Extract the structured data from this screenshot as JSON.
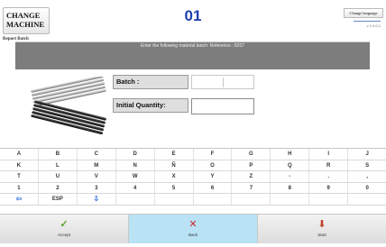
{
  "header": {
    "change_machine": "CHANGE\nMACHINE",
    "screen_title": "Report Batch",
    "screen_number": "01",
    "change_language": "Change language",
    "version": "v 1.0.0.1"
  },
  "message": {
    "text": "Enter the following material batch: Reference : 8207"
  },
  "form": {
    "batch_label": "Batch :",
    "batch_value": "",
    "initial_quantity_label": "Initial Quantity:",
    "initial_quantity_value": ""
  },
  "keyboard": {
    "rows": [
      [
        "A",
        "B",
        "C",
        "D",
        "E",
        "F",
        "G",
        "H",
        "I",
        "J"
      ],
      [
        "K",
        "L",
        "M",
        "N",
        "Ñ",
        "O",
        "P",
        "Q",
        "R",
        "S"
      ],
      [
        "T",
        "U",
        "V",
        "W",
        "X",
        "Y",
        "Z",
        "-",
        ".",
        ","
      ],
      [
        "1",
        "2",
        "3",
        "4",
        "5",
        "6",
        "7",
        "8",
        "9",
        "0"
      ],
      [
        "⇦",
        "ESP",
        "⇩",
        "",
        "",
        "",
        "",
        "",
        "",
        ""
      ]
    ]
  },
  "actions": {
    "accept": "Accept",
    "back": "Back",
    "start": "Start"
  },
  "icons": {
    "accept": "check-icon",
    "back": "x-icon",
    "start": "start-icon"
  },
  "colors": {
    "title_blue": "#1f3fb0",
    "message_bar": "#7d7d7d",
    "selected_action": "#b9e2f5"
  }
}
